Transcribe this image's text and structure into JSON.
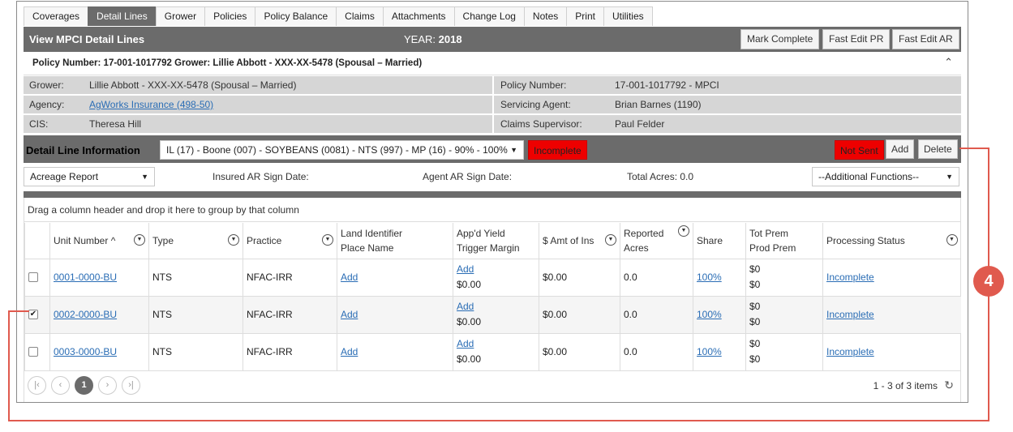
{
  "tabs": [
    "Coverages",
    "Detail Lines",
    "Grower",
    "Policies",
    "Policy Balance",
    "Claims",
    "Attachments",
    "Change Log",
    "Notes",
    "Print",
    "Utilities"
  ],
  "header": {
    "title": "View MPCI Detail Lines",
    "year_label": "YEAR:",
    "year_value": "2018",
    "btn_mark_complete": "Mark Complete",
    "btn_fast_edit_pr": "Fast Edit PR",
    "btn_fast_edit_ar": "Fast Edit AR"
  },
  "policy_line": "Policy Number: 17-001-1017792 Grower: Lillie Abbott - XXX-XX-5478 (Spousal – Married)",
  "info": {
    "grower_label": "Grower:",
    "grower_value": "Lillie Abbott - XXX-XX-5478 (Spousal – Married)",
    "agency_label": "Agency:",
    "agency_value": "AgWorks Insurance (498-50)",
    "cis_label": "CIS:",
    "cis_value": "Theresa Hill",
    "policy_label": "Policy Number:",
    "policy_value": "17-001-1017792 - MPCI",
    "agent_label": "Servicing Agent:",
    "agent_value": "Brian Barnes (1190)",
    "claims_label": "Claims Supervisor:",
    "claims_value": "Paul Felder"
  },
  "detail": {
    "title": "Detail Line Information",
    "select_value": "IL (17) - Boone (007) - SOYBEANS (0081) - NTS (997) - MP (16) - 90% - 100%",
    "status_badge": "Incomplete",
    "sent_badge": "Not Sent",
    "add_label": "Add",
    "delete_label": "Delete"
  },
  "filter": {
    "report_select": "Acreage Report",
    "insured_sign": "Insured AR Sign Date:",
    "agent_sign": "Agent AR Sign Date:",
    "total_acres": "Total Acres: 0.0",
    "functions_select": "--Additional Functions--"
  },
  "grid": {
    "group_hint": "Drag a column header and drop it here to group by that column",
    "headers": {
      "unit": "Unit Number",
      "sort_arrow": "^",
      "type": "Type",
      "practice": "Practice",
      "land1": "Land Identifier",
      "land2": "Place Name",
      "yield1": "App'd Yield",
      "yield2": "Trigger Margin",
      "amt": "$ Amt of Ins",
      "acres1": "Reported",
      "acres2": "Acres",
      "share": "Share",
      "prem1": "Tot Prem",
      "prem2": "Prod Prem",
      "status": "Processing Status"
    },
    "rows": [
      {
        "unit": "0001-0000-BU",
        "type": "NTS",
        "practice": "NFAC-IRR",
        "land": "Add",
        "yield_link": "Add",
        "yield_val": "$0.00",
        "amt": "$0.00",
        "acres": "0.0",
        "share": "100%",
        "prem1": "$0",
        "prem2": "$0",
        "status": "Incomplete",
        "checked": false
      },
      {
        "unit": "0002-0000-BU",
        "type": "NTS",
        "practice": "NFAC-IRR",
        "land": "Add",
        "yield_link": "Add",
        "yield_val": "$0.00",
        "amt": "$0.00",
        "acres": "0.0",
        "share": "100%",
        "prem1": "$0",
        "prem2": "$0",
        "status": "Incomplete",
        "checked": true
      },
      {
        "unit": "0003-0000-BU",
        "type": "NTS",
        "practice": "NFAC-IRR",
        "land": "Add",
        "yield_link": "Add",
        "yield_val": "$0.00",
        "amt": "$0.00",
        "acres": "0.0",
        "share": "100%",
        "prem1": "$0",
        "prem2": "$0",
        "status": "Incomplete",
        "checked": false
      }
    ]
  },
  "pager": {
    "current_page": "1",
    "summary": "1 - 3 of 3 items"
  },
  "callout": {
    "number": "4",
    "color": "#e05a4e"
  }
}
